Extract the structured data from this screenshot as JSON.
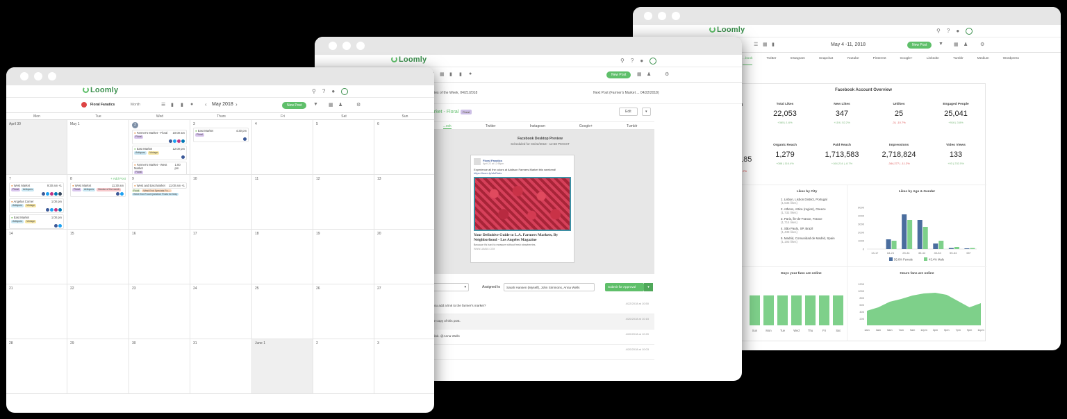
{
  "app": {
    "logo": "Loomly"
  },
  "calendar": {
    "brand": "Floral Fanatics",
    "view": "Month",
    "month": "May 2018",
    "new_post": "New Post",
    "weekdays": [
      "Mon",
      "Tue",
      "Wed",
      "Thurs",
      "Fri",
      "Sat",
      "Sun"
    ],
    "rows": [
      [
        "April 30",
        "May 1",
        "2",
        "3",
        "4",
        "5",
        "6"
      ],
      [
        "7",
        "8",
        "9",
        "10",
        "11",
        "12",
        "13"
      ],
      [
        "14",
        "15",
        "16",
        "17",
        "18",
        "19",
        "20"
      ],
      [
        "21",
        "22",
        "23",
        "24",
        "25",
        "26",
        "27"
      ],
      [
        "28",
        "29",
        "30",
        "31",
        "June 1",
        "2",
        "3"
      ]
    ],
    "add_post": "+ Add Post",
    "events": {
      "wed2": [
        {
          "title": "Farmer's Market - Floral",
          "time": "10:00 am"
        },
        {
          "title": "East Market",
          "time": "12:00 pm"
        },
        {
          "title": "Farmer's Market - West Market",
          "time": "1:00 pm"
        }
      ],
      "thu3": [
        {
          "title": "East Market",
          "time": "4:30 pm"
        }
      ],
      "mon7": [
        {
          "title": "West Market",
          "time": "9:30 am +1"
        },
        {
          "title": "Angelas Corner",
          "time": "1:00 pm"
        },
        {
          "title": "East Market",
          "time": "1:00 pm"
        },
        {
          "title": "Farmer's Market - Floral",
          "time": "1:00 pm"
        }
      ],
      "tue8": [
        {
          "title": "West Market",
          "time": "11:30 am"
        }
      ],
      "wed9": [
        {
          "title": "West and East Market",
          "time": "11:00 am +1"
        },
        {
          "title": "West Updates For Over...",
          "time": ""
        }
      ]
    },
    "tags": {
      "floral": "Floral",
      "antiques": "Antiques",
      "vintage": "Vintage",
      "vendor": "Vendor of the week",
      "food": "Food",
      "west_end_food": "West End Food Question Posts for May",
      "west_end_specials": "West End Specials Fo..."
    }
  },
  "post": {
    "prev_link": "...ies of the Week, 04/21/2018",
    "next_link": "Next Post (Farmer's Market ... 04/22/2018)",
    "title_frag": "arket - Floral",
    "title_badge": "Floral",
    "edit": "Edit",
    "new_post": "New Post",
    "tabs": [
      "...ook",
      "Twitter",
      "Instagram",
      "Google+",
      "Tumblr"
    ],
    "preview_title": "Facebook Desktop Preview",
    "preview_sub": "Scheduled for 04/22/2018 - 12:58 PM EST",
    "card_page": "Floral Fanatics",
    "card_date": "April 22 at 12:58pm",
    "card_text": "Experience all the colors at Addison Farmers Market this weekend!",
    "card_link": "https://loom.ly/sfuRsbs",
    "card_headline": "Your Definitive Guide to L.A. Farmers Markets, By Neighborhood - Los Angeles Magazine",
    "card_desc": "Because it's hard to measure without fresh strawberries.",
    "card_domain": "WWW.LAMAG.COM",
    "assigned_label": "Assigned to",
    "assigned_value": "Sarah Hansen (Myself), John Simmons, Anna Wells",
    "submit": "Submit for Approval",
    "comments": [
      {
        "text": "Can you add a link to the farmer's market?",
        "time": "4/22/2018 at 10:50"
      },
      {
        "text": "...d the copy of this post.",
        "time": "4/20/2018 at 10:15"
      },
      {
        "text": "...me link. @Anna Wells",
        "time": "4/20/2018 at 10:20"
      },
      {
        "text": "",
        "time": "4/20/2018 at 10:03"
      }
    ]
  },
  "analytics": {
    "new_post": "New Post",
    "date_range": "May 4 -11, 2018",
    "tabs": [
      "...book",
      "Twitter",
      "Instagram",
      "Snapchat",
      "Youtube",
      "Pinterest",
      "Google+",
      "LinkedIn",
      "Tumblr",
      "Medium",
      "Wordpress"
    ],
    "overview_title": "Facebook Account Overview",
    "stats_row1": [
      {
        "label": "Total Likes",
        "value": "22,053",
        "sub": "+365 | 1.6%"
      },
      {
        "label": "New Likes",
        "value": "347",
        "sub": "+119 | 52.2%"
      },
      {
        "label": "Unlikes",
        "value": "25",
        "sub": "-3 | -10.7%"
      },
      {
        "label": "Engaged People",
        "value": "25,041",
        "sub": "+916 | 3.8%"
      }
    ],
    "stats_row2": [
      {
        "label": "Organic Reach",
        "value": "1,279",
        "sub": "+088 | 116.4%"
      },
      {
        "label": "Paid Reach",
        "value": "1,713,583",
        "sub": "+164,214 | -8.7%"
      },
      {
        "label": "Impressions",
        "value": "2,718,824",
        "sub": "-344,277 | -11.2%"
      },
      {
        "label": "Video Views",
        "value": "133",
        "sub": "+93 | 232.5%"
      }
    ],
    "partial_value": "185",
    "partial_sub": "-7%",
    "partial_label": "d",
    "likes_by_city_title": "Likes by City",
    "cities": [
      {
        "name": "1. Lisbon, Lisbon District, Portugal",
        "likes": "(1,536 likes)"
      },
      {
        "name": "2. Athens, Attica (region), Greece",
        "likes": "(1,732 likes)"
      },
      {
        "name": "3. Paris, Île-de-France, France",
        "likes": "(1,714 likes)"
      },
      {
        "name": "4. São Paulo, SP, Brazil",
        "likes": "(1,438 likes)"
      },
      {
        "name": "5. Madrid, Comunidad de Madrid, Spain",
        "likes": "(1,193 likes)"
      }
    ],
    "age_gender_title": "Likes by Age & Gender",
    "days_title": "Days your fans are online",
    "hours_title": "Hours fans are online"
  },
  "chart_data": [
    {
      "type": "bar",
      "title": "Likes by Age & Gender",
      "categories": [
        "13-17",
        "18-24",
        "25-34",
        "35-44",
        "45-54",
        "55-64",
        "65+"
      ],
      "series": [
        {
          "name": "56.6% Female",
          "values": [
            0,
            1400,
            5000,
            4200,
            800,
            150,
            100
          ]
        },
        {
          "name": "43.4% Male",
          "values": [
            0,
            1200,
            4200,
            3200,
            1200,
            300,
            150
          ]
        }
      ],
      "ylim": [
        0,
        6000
      ],
      "yticks": [
        "6000",
        "4000",
        "3000",
        "2000",
        "1000",
        "0"
      ],
      "colors": [
        "#4a6d9e",
        "#7ed08a"
      ]
    },
    {
      "type": "bar",
      "title": "Days your fans are online",
      "categories": [
        "Sun",
        "Mon",
        "Tue",
        "Wed",
        "Thu",
        "Fri",
        "Sat"
      ],
      "values": [
        0.8,
        0.8,
        0.8,
        0.8,
        0.8,
        0.8,
        0.8
      ],
      "colors": [
        "#7ed08a"
      ]
    },
    {
      "type": "area",
      "title": "Hours fans are online",
      "x": [
        "1am",
        "3am",
        "5am",
        "7am",
        "9am",
        "12pm",
        "3pm",
        "5pm",
        "7pm",
        "9pm",
        "11pm"
      ],
      "values": [
        420,
        520,
        680,
        760,
        860,
        920,
        940,
        880,
        700,
        520,
        640
      ],
      "yticks": [
        "1200",
        "1000",
        "800",
        "600",
        "400",
        "200"
      ],
      "colors": [
        "#7ed08a"
      ]
    }
  ]
}
